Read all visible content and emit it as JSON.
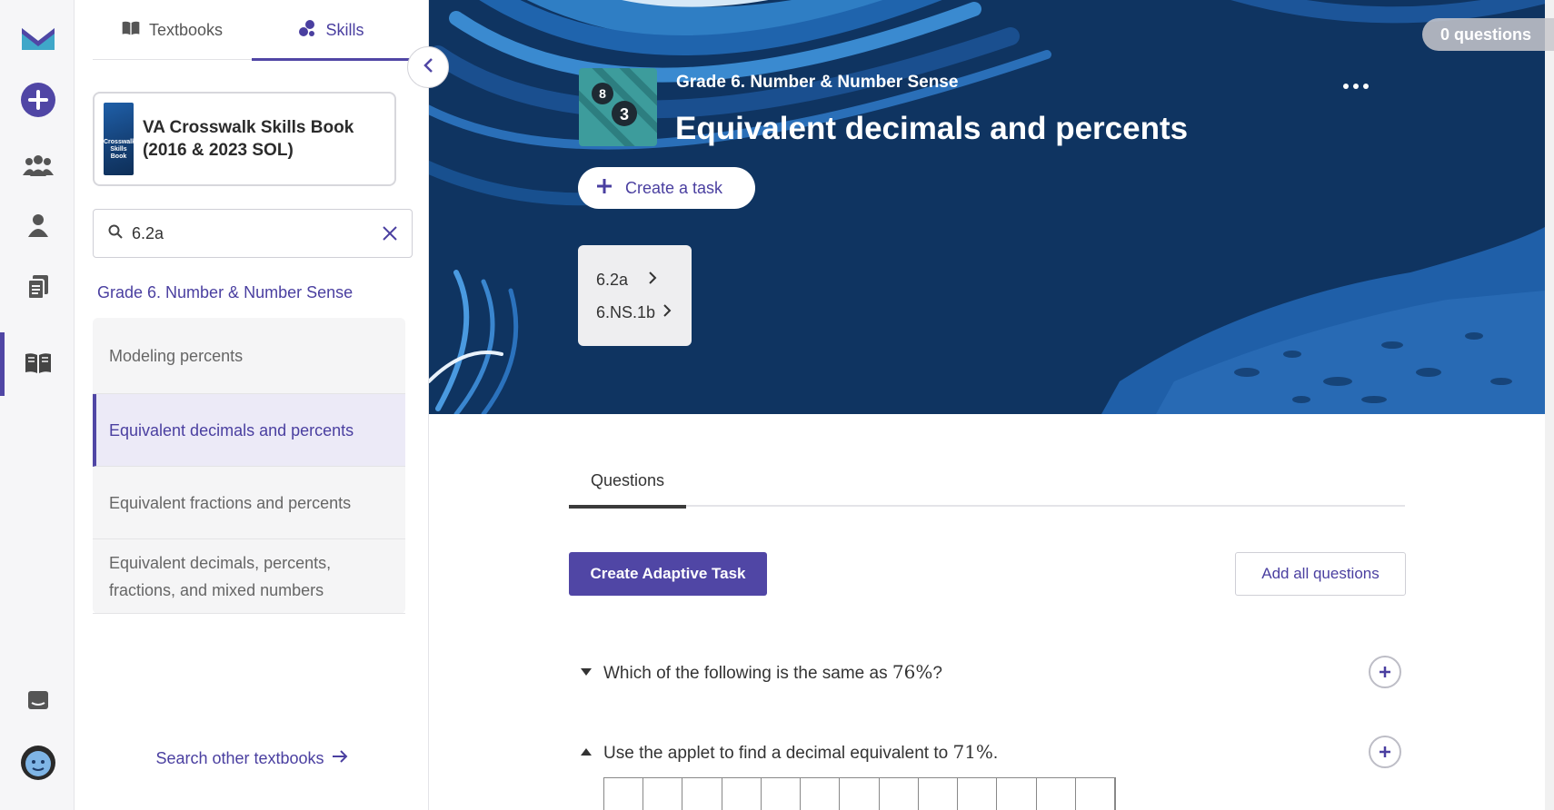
{
  "rail": {
    "items": [
      "logo-icon",
      "add-icon",
      "groups-icon",
      "person-icon",
      "documents-icon",
      "book-icon",
      "chat-icon",
      "avatar-icon"
    ]
  },
  "sidebar": {
    "tabs": [
      {
        "label": "Textbooks",
        "icon": "book-icon"
      },
      {
        "label": "Skills",
        "icon": "skills-icon"
      }
    ],
    "book": {
      "title": "VA Crosswalk Skills Book (2016 & 2023 SOL)",
      "cover_text": "Crosswalk Skills Book"
    },
    "search": {
      "value": "6.2a"
    },
    "group_title": "Grade 6. Number & Number Sense",
    "skills": [
      {
        "label": "Modeling percents",
        "active": false
      },
      {
        "label": "Equivalent decimals and percents",
        "active": true
      },
      {
        "label": "Equivalent fractions and percents",
        "active": false
      },
      {
        "label": "Equivalent decimals, percents, fractions, and mixed numbers",
        "active": false
      }
    ],
    "search_other": "Search other textbooks"
  },
  "hero": {
    "question_count": "0 questions",
    "breadcrumb": "Grade 6. Number & Number Sense",
    "title": "Equivalent decimals and percents",
    "create_task": "Create a task",
    "icon_numbers": [
      "8",
      "3"
    ],
    "standards": [
      "6.2a",
      "6.NS.1b"
    ],
    "colors": {
      "background": "#0f3461",
      "accent": "#5046a5"
    }
  },
  "main": {
    "tab": "Questions",
    "create_adaptive": "Create Adaptive Task",
    "add_all": "Add all questions",
    "questions": [
      {
        "prefix": "Which of the following is the same as ",
        "math": "76%",
        "suffix": "?",
        "expanded": false
      },
      {
        "prefix": "Use the applet to find a decimal equivalent to ",
        "math": "71%",
        "suffix": ".",
        "expanded": true
      }
    ]
  }
}
